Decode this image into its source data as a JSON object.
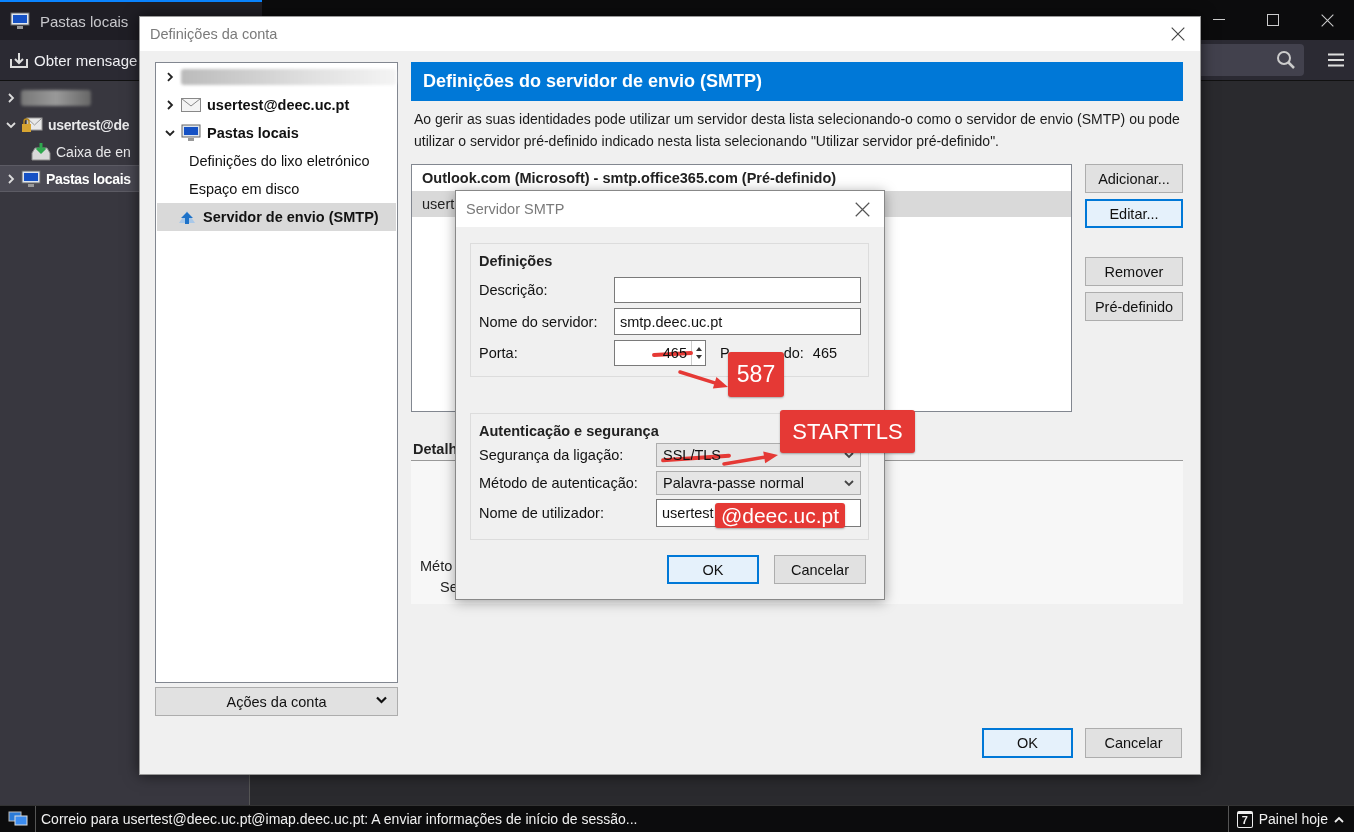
{
  "app": {
    "tab": {
      "title": "Pastas locais"
    },
    "toolbar": {
      "get_messages": "Obter mensage"
    },
    "folders": [
      {
        "kind": "redacted",
        "expanded": false,
        "selected": false
      },
      {
        "kind": "account",
        "label": "usertest@de",
        "expanded": true,
        "selected": false,
        "children": [
          {
            "kind": "inbox",
            "label": "Caixa de en",
            "selected": false
          }
        ]
      },
      {
        "kind": "local",
        "label": "Pastas locais",
        "expanded": false,
        "selected": true
      }
    ],
    "status_bar": {
      "message": "Correio para usertest@deec.uc.pt@imap.deec.uc.pt: A enviar informações de início de sessão...",
      "today_day": "7",
      "today_label": "Painel hoje"
    }
  },
  "account_dialog": {
    "title": "Definições da conta",
    "tree": [
      {
        "kind": "redacted",
        "expanded": false,
        "selected": false
      },
      {
        "kind": "account",
        "label": "usertest@deec.uc.pt",
        "expanded": false,
        "selected": false
      },
      {
        "kind": "local",
        "label": "Pastas locais",
        "expanded": true,
        "selected": false,
        "children": [
          {
            "kind": "setting",
            "label": "Definições do lixo eletrónico",
            "selected": false
          },
          {
            "kind": "setting",
            "label": "Espaço em disco",
            "selected": false
          },
          {
            "kind": "smtp",
            "label": "Servidor de envio (SMTP)",
            "selected": true
          }
        ]
      }
    ],
    "account_actions": "Ações da conta",
    "heading": "Definições do servidor de envio (SMTP)",
    "description": "Ao gerir as suas identidades pode utilizar um servidor desta lista selecionando-o como o servidor de envio (SMTP) ou pode utilizar o servidor pré-definido indicado nesta lista selecionando \"Utilizar servidor pré-definido\".",
    "servers": [
      {
        "label": "Outlook.com (Microsoft) - smtp.office365.com (Pré-definido)",
        "default": true,
        "selected": false
      },
      {
        "label": "usert",
        "default": false,
        "selected": true
      }
    ],
    "side_buttons": [
      {
        "label": "Adicionar...",
        "focused": false
      },
      {
        "label": "Editar...",
        "focused": true
      },
      {
        "label": "Remover",
        "focused": false
      },
      {
        "label": "Pré-definido",
        "focused": false
      }
    ],
    "details_heading": "Detalh",
    "details_lines": [
      "Méto",
      "Se"
    ],
    "buttons": [
      {
        "label": "OK",
        "focused": true
      },
      {
        "label": "Cancelar",
        "focused": false
      }
    ]
  },
  "smtp_dialog": {
    "title": "Servidor SMTP",
    "settings_group": {
      "title": "Definições",
      "description_label": "Descrição:",
      "server_label": "Nome do servidor:",
      "server_value": "smtp.deec.uc.pt",
      "port_label": "Porta:",
      "port_value": "465",
      "default_port_label_parts": [
        "P",
        "do:"
      ],
      "default_port": "465"
    },
    "security_group": {
      "title": "Autenticação e segurança",
      "connection_label": "Segurança da ligação:",
      "connection_value": "SSL/TLS",
      "auth_label": "Método de autenticação:",
      "auth_value": "Palavra-passe normal",
      "user_label": "Nome de utilizador:",
      "user_value": "usertest"
    },
    "buttons": [
      {
        "label": "OK",
        "focused": true
      },
      {
        "label": "Cancelar",
        "focused": false
      }
    ]
  },
  "annotations": [
    {
      "kind": "badge",
      "text": "587"
    },
    {
      "kind": "badge",
      "text": "STARTTLS"
    },
    {
      "kind": "badge",
      "text": "@deec.uc.pt"
    },
    {
      "kind": "arrow"
    },
    {
      "kind": "arrow"
    },
    {
      "kind": "strike"
    },
    {
      "kind": "strike"
    }
  ]
}
